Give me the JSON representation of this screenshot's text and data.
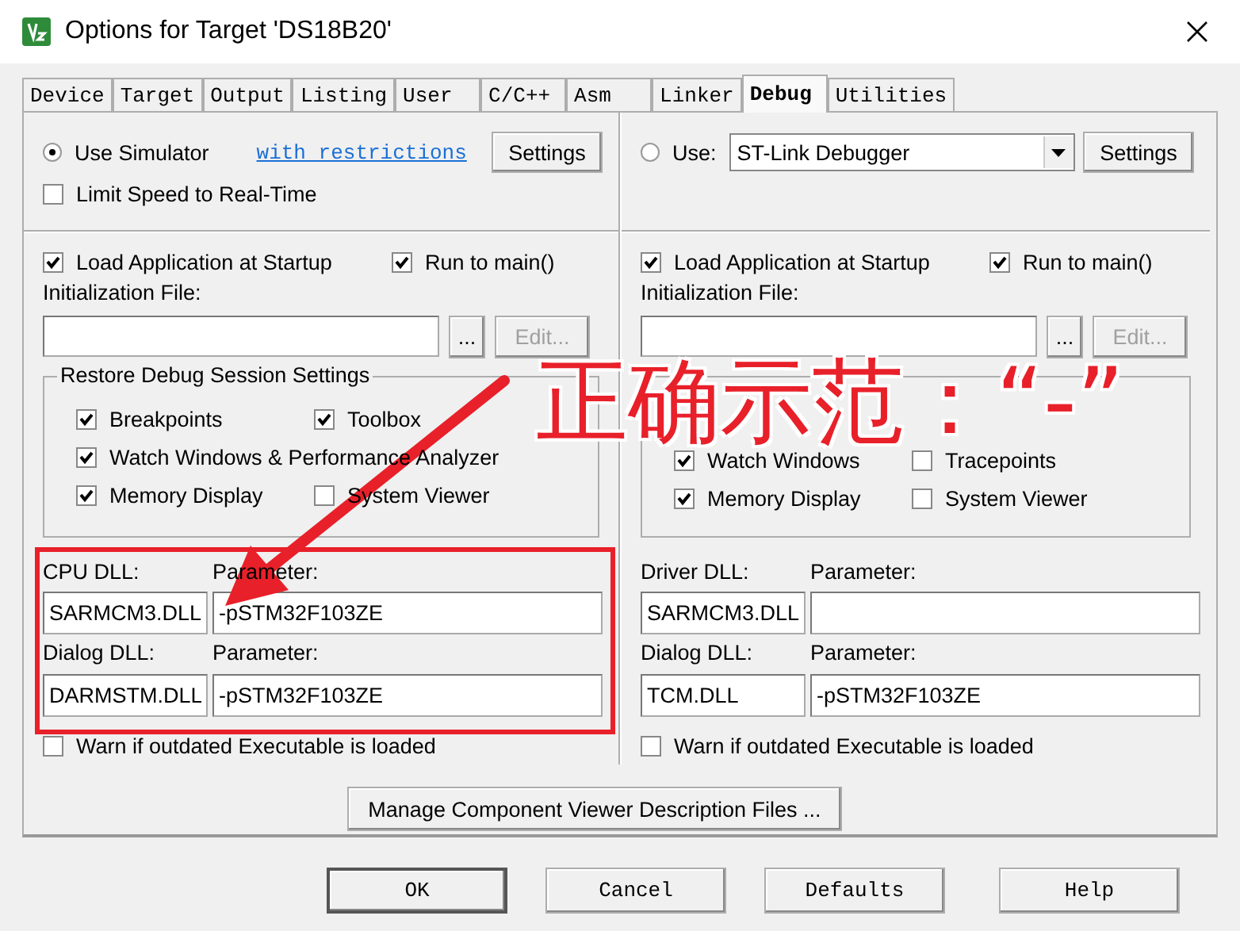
{
  "window": {
    "title": "Options for Target 'DS18B20'"
  },
  "tabs": [
    {
      "label": "Device",
      "selected": false
    },
    {
      "label": "Target",
      "selected": false
    },
    {
      "label": "Output",
      "selected": false
    },
    {
      "label": "Listing",
      "selected": false
    },
    {
      "label": "User",
      "selected": false
    },
    {
      "label": "C/C++",
      "selected": false
    },
    {
      "label": "Asm",
      "selected": false
    },
    {
      "label": "Linker",
      "selected": false
    },
    {
      "label": "Debug",
      "selected": true
    },
    {
      "label": "Utilities",
      "selected": false
    }
  ],
  "panels": [
    {
      "source": {
        "kind": "simulator",
        "label": "Use Simulator",
        "selected": true,
        "link": "with restrictions",
        "settings": "Settings"
      },
      "limit_speed": {
        "label": "Limit Speed to Real-Time",
        "checked": false
      },
      "startup": [
        {
          "label": "Load Application at Startup",
          "checked": true
        },
        {
          "label": "Run to main()",
          "checked": true
        }
      ],
      "init_file": {
        "label": "Initialization File:",
        "browse": "...",
        "edit": "Edit...",
        "edit_disabled": true
      },
      "restore": {
        "legend": "Restore Debug Session Settings",
        "items": [
          {
            "label": "Breakpoints",
            "checked": true
          },
          {
            "label": "Toolbox",
            "checked": true
          },
          {
            "label": "Watch Windows & Performance Analyzer",
            "checked": true
          },
          {
            "label": "Memory Display",
            "checked": true
          },
          {
            "label": "System Viewer",
            "checked": false
          }
        ]
      },
      "dlls": [
        {
          "label": "CPU DLL:",
          "value": "SARMCM3.DLL",
          "param_label": "Parameter:",
          "param": "-pSTM32F103ZE"
        },
        {
          "label": "Dialog DLL:",
          "value": "DARMSTM.DLL",
          "param_label": "Parameter:",
          "param": "-pSTM32F103ZE"
        }
      ],
      "warn": {
        "label": "Warn if outdated Executable is loaded",
        "checked": false
      }
    },
    {
      "source": {
        "kind": "driver",
        "label": "Use:",
        "selected": false,
        "driver": "ST-Link Debugger",
        "settings": "Settings"
      },
      "startup": [
        {
          "label": "Load Application at Startup",
          "checked": true
        },
        {
          "label": "Run to main()",
          "checked": true
        }
      ],
      "init_file": {
        "label": "Initialization File:",
        "browse": "...",
        "edit": "Edit...",
        "edit_disabled": true
      },
      "restore": {
        "items": [
          {
            "label": "Watch Windows",
            "checked": true
          },
          {
            "label": "Tracepoints",
            "checked": false
          },
          {
            "label": "Memory Display",
            "checked": true
          },
          {
            "label": "System Viewer",
            "checked": false
          }
        ]
      },
      "dlls": [
        {
          "label": "Driver DLL:",
          "value": "SARMCM3.DLL",
          "param_label": "Parameter:"
        },
        {
          "label": "Dialog DLL:",
          "value": "TCM.DLL",
          "param_label": "Parameter:",
          "param": "-pSTM32F103ZE"
        }
      ],
      "warn": {
        "label": "Warn if outdated Executable is loaded",
        "checked": false
      }
    }
  ],
  "manage_button": "Manage Component Viewer Description Files ...",
  "buttons": [
    "OK",
    "Cancel",
    "Defaults",
    "Help"
  ],
  "annotation": {
    "caption": "正确示范：“-”"
  }
}
